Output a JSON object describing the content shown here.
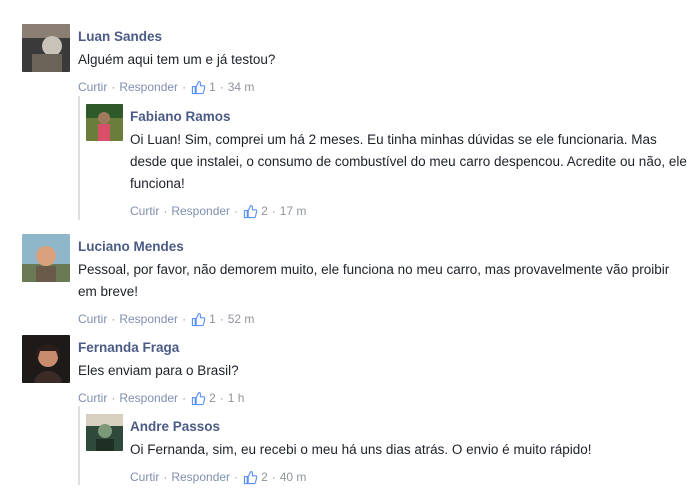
{
  "actions": {
    "like": "Curtir",
    "reply": "Responder",
    "sep": "·"
  },
  "comments": [
    {
      "name": "Luan Sandes",
      "text": "Alguém aqui tem um e já testou?",
      "likes": "1",
      "time": "34 m",
      "avatar": {
        "colors": [
          "#3a3a3a",
          "#8a7f72",
          "#c9c2b8"
        ]
      }
    },
    {
      "name": "Fabiano Ramos",
      "text": "Oi Luan! Sim, comprei um há 2 meses. Eu tinha minhas dúvidas se ele funcionaria. Mas desde que instalei, o consumo de combustível do meu carro despencou. Acredite ou não, ele funciona!",
      "likes": "2",
      "time": "17 m",
      "avatar": {
        "colors": [
          "#2e5a2a",
          "#d94f6a",
          "#6b7d3a"
        ]
      }
    },
    {
      "name": "Luciano Mendes",
      "text": "Pessoal, por favor, não demorem muito, ele funciona no meu carro, mas provavelmente vão proibir em breve!",
      "likes": "1",
      "time": "52 m",
      "avatar": {
        "colors": [
          "#8fb6c9",
          "#d9a27c",
          "#6a5a4a"
        ]
      }
    },
    {
      "name": "Fernanda Fraga",
      "text": "Eles enviam para o Brasil?",
      "likes": "2",
      "time": "1 h",
      "avatar": {
        "colors": [
          "#1e1a1a",
          "#c78b6d",
          "#3b2a25"
        ]
      }
    },
    {
      "name": "Andre Passos",
      "text": "Oi Fernanda, sim, eu recebi o meu há uns dias atrás. O envio é muito rápido!",
      "likes": "2",
      "time": "40 m",
      "avatar": {
        "colors": [
          "#2f4a3a",
          "#7c9a7a",
          "#d8d0c0"
        ]
      }
    }
  ],
  "colors": {
    "name": "#4b5b85",
    "link": "#7f8eaf",
    "meta": "#90949c",
    "text": "#1d2129"
  }
}
